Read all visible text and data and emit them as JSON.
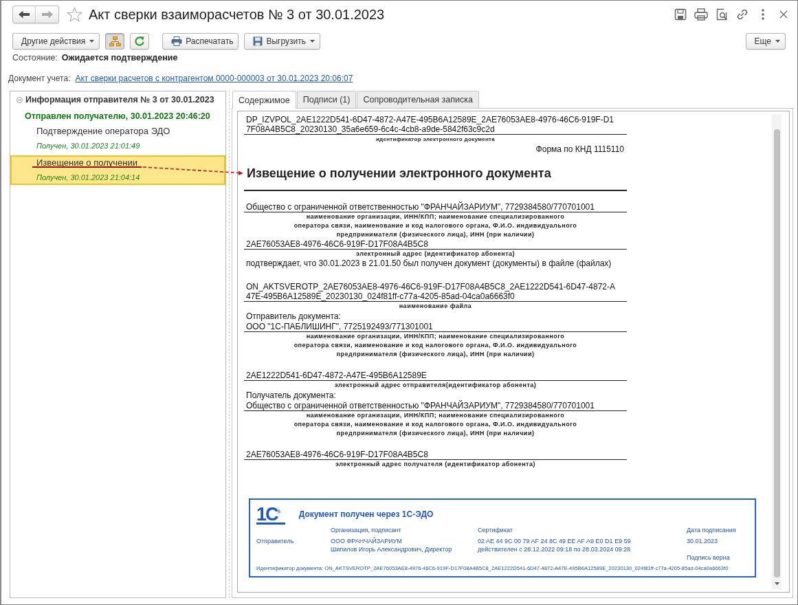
{
  "window": {
    "title": "Акт сверки взаиморасчетов № 3 от 30.01.2023",
    "navigation": {
      "back": {
        "disabled": false
      },
      "forward": {
        "disabled": true
      }
    }
  },
  "toolbar": {
    "actions_menu": {
      "label": "Другие действия"
    },
    "structure_toggle": {
      "pressed": true
    },
    "print_button": {
      "label": "Распечатать"
    },
    "export_menu": {
      "label": "Выгрузить"
    },
    "more_menu": {
      "label": "Еще"
    }
  },
  "status": {
    "label": "Состояние:",
    "value": "Ожидается подтверждение"
  },
  "accounting_document": {
    "label": "Документ учета:",
    "link": "Акт сверки расчетов с контрагентом 0000-000003 от 30.01.2023 20:06:07"
  },
  "tree": {
    "title": "Информация отправителя № 3 от 30.01.2023",
    "expanded": true,
    "state": "Отправлен получателю, 30.01.2023 20:46:20",
    "children": [
      {
        "title": "Подтверждение оператора ЭДО",
        "status": "Получен, 30.01.2023 21:01:49",
        "selected": false
      },
      {
        "title": "Извещение о получении",
        "status": "Получен, 30.01.2023 21:04:14",
        "selected": true
      }
    ]
  },
  "tabs": [
    {
      "label": "Содержимое",
      "selected": true
    },
    {
      "label": "Подписи (1)",
      "selected": false
    },
    {
      "label": "Сопроводительная записка",
      "selected": false
    }
  ],
  "document": {
    "identifier": {
      "value": "DP_IZVPOL_2AE1222D541-6D47-4872-A47E-495B6A12589E_2AE76053AE8-4976-46C6-919F-D17F08A4B5C8_20230130_35a6e659-6c4c-4cb8-a9de-5842f63c9c2d",
      "caption": "идентификатор электронного документа"
    },
    "form_code": "Форма по КНД 1115110",
    "heading": "Извещение о получении электронного документа",
    "receiver": {
      "value": "Общество с ограниченной ответственностью \"ФРАНЧАЙЗАРИУМ\", 7729384580/770701001",
      "caption": "наименование организации, ИНН/КПП; наименование специализированного оператора связи, наименование и код налогового органа, Ф.И.О. индивидуального предпринимателя (физического лица), ИНН (при наличии)"
    },
    "receiver_address": {
      "value": "2AE76053AE8-4976-46C6-919F-D17F08A4B5C8",
      "caption": "электронный адрес (идентификатор абонента)"
    },
    "confirmation": "подтверждает, что 30.01.2023 в 21.01.50 был получен документ (документы) в файле (файлах)",
    "file_name": {
      "value": "ON_AKTSVEROTP_2AE76053AE8-4976-46C6-919F-D17F08A4B5C8_2AE1222D541-6D47-4872-A47E-495B6A12589E_20230130_024f81ff-c77a-4205-85ad-04ca0a6663f0",
      "caption": "наименование файла"
    },
    "parties": [
      {
        "label": "Отправитель документа:",
        "organization": {
          "value": "ООО \"1С-ПАБЛИШИНГ\", 7725192493/771301001",
          "caption": "наименование организации, ИНН/КПП; наименование специализированного оператора связи, наименование и код налогового органа, Ф.И.О. индивидуального предпринимателя (физического лица), ИНН (при наличии)"
        },
        "address": {
          "value": "2AE1222D541-6D47-4872-A47E-495B6A12589E",
          "caption": "электронный адрес отправителя(идентификатор абонента)"
        }
      },
      {
        "label": "Получатель документа:",
        "organization": {
          "value": "Общество с ограниченной ответственностью \"ФРАНЧАЙЗАРИУМ\", 7729384580/770701001",
          "caption": "наименование организации, ИНН/КПП; наименование специализированного оператора связи, наименование и код налогового органа, Ф.И.О. индивидуального предпринимателя (физического лица), ИНН (при наличии)"
        },
        "address": {
          "value": "2AE76053AE8-4976-46C6-919F-D17F08A4B5C8",
          "caption": "электронный адрес получателя (идентификатор абонента)"
        }
      }
    ]
  },
  "stamp": {
    "logo": "1С$^{®}$",
    "title": "Документ получен через 1С-ЭДО",
    "columns": [
      "Организация, подписант",
      "Сертификат",
      "Дата подписания"
    ],
    "signers": [
      {
        "role": "Отправитель",
        "organization": "ООО ФРАНЧАЙЗАРИУМ",
        "signer": "Шипилов Игорь Александрович, Директор",
        "certificate": "02 AE 44 9C 00 79 AF 24 8C 49 EE AF A9 E0 D1 E9 59",
        "validity": "действителен с 28.12.2022 09:18 по 28.03.2024 09:28",
        "date": "30.01.2023",
        "verdict": "Подпись верна"
      }
    ],
    "document_id": "Идентификатор документа: ON_AKTSVEROTP_2AE76053AE8-4976-46C6-919F-D17F08A4B5C8_2AE1222D541-6D47-4872-A47E-495B6A12589E_20230130_024f81ff-c77a-4205-85ad-04ca0a6663f0"
  }
}
